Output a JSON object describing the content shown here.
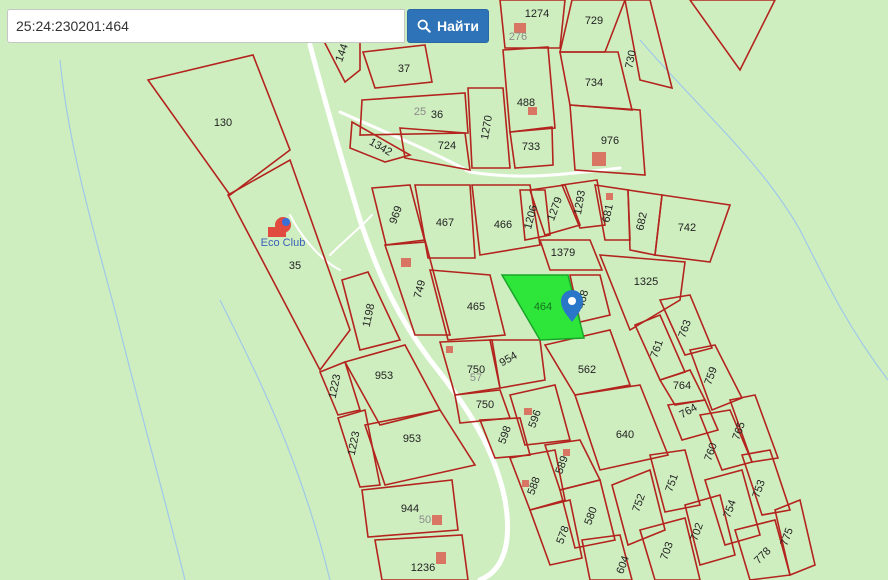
{
  "search": {
    "value": "25:24:230201:464",
    "button_label": "Найти",
    "button_icon": "search-icon"
  },
  "colors": {
    "parcel_border": "#b3241e",
    "selected_fill": "#2ee63a",
    "map_background": "#cfeec0",
    "road": "#ffffff",
    "marker": "#2a77c9"
  },
  "poi": {
    "label": "Eco Club",
    "icon": "eco-club-icon"
  },
  "selected_parcel": {
    "label": "464",
    "marker_icon": "location-pin-icon"
  },
  "parcels": {
    "p130": "130",
    "p35": "35",
    "p1198": "1198",
    "p1223a": "1223",
    "p1223b": "1223",
    "p953a": "953",
    "p953b": "953",
    "p944": "944",
    "p1236": "1236",
    "p144": "144",
    "p37": "37",
    "p36": "36",
    "p1342": "1342",
    "p724": "724",
    "p1270": "1270",
    "p488": "488",
    "p733": "733",
    "p1274": "1274",
    "p729": "729",
    "p730": "730",
    "p734": "734",
    "p976": "976",
    "p969": "969",
    "p467": "467",
    "p466": "466",
    "p1206": "1206",
    "p1279": "1279",
    "p1293": "1293",
    "p681": "681",
    "p682": "682",
    "p742": "742",
    "p1379": "1379",
    "p749": "749",
    "p465": "465",
    "p468": "468",
    "p1325": "1325",
    "p750a": "750",
    "p954": "954",
    "p750b": "750",
    "p562": "562",
    "p596": "596",
    "p598": "598",
    "p640": "640",
    "p589": "589",
    "p588": "588",
    "p580": "580",
    "p578": "578",
    "p604": "604",
    "p763": "763",
    "p761": "761",
    "p764a": "764",
    "p759": "759",
    "p764b": "764",
    "p765": "765",
    "p760": "760",
    "p752": "752",
    "p751": "751",
    "p753": "753",
    "p754": "754",
    "p703": "703",
    "p702": "702",
    "p778": "778",
    "p775": "775"
  },
  "ghost_labels": {
    "g25": "25",
    "g276": "276",
    "g57": "57",
    "g50": "50"
  }
}
